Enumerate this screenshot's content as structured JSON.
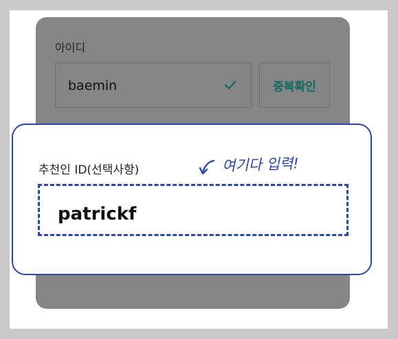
{
  "signup": {
    "id_label": "아이디",
    "id_value": "baemin",
    "duplicate_check_label": "중복확인"
  },
  "modal": {
    "referral_label": "추천인 ID(선택사항)",
    "referral_value": "patrickf",
    "annotation_text": "여기다 입력!"
  },
  "colors": {
    "accent_blue": "#2b46a8",
    "brand_teal": "#0a6b5e",
    "overlay_gray": "#858585"
  },
  "icons": {
    "check": "check-icon",
    "annotation_arrow": "hand-drawn-arrow-icon"
  }
}
